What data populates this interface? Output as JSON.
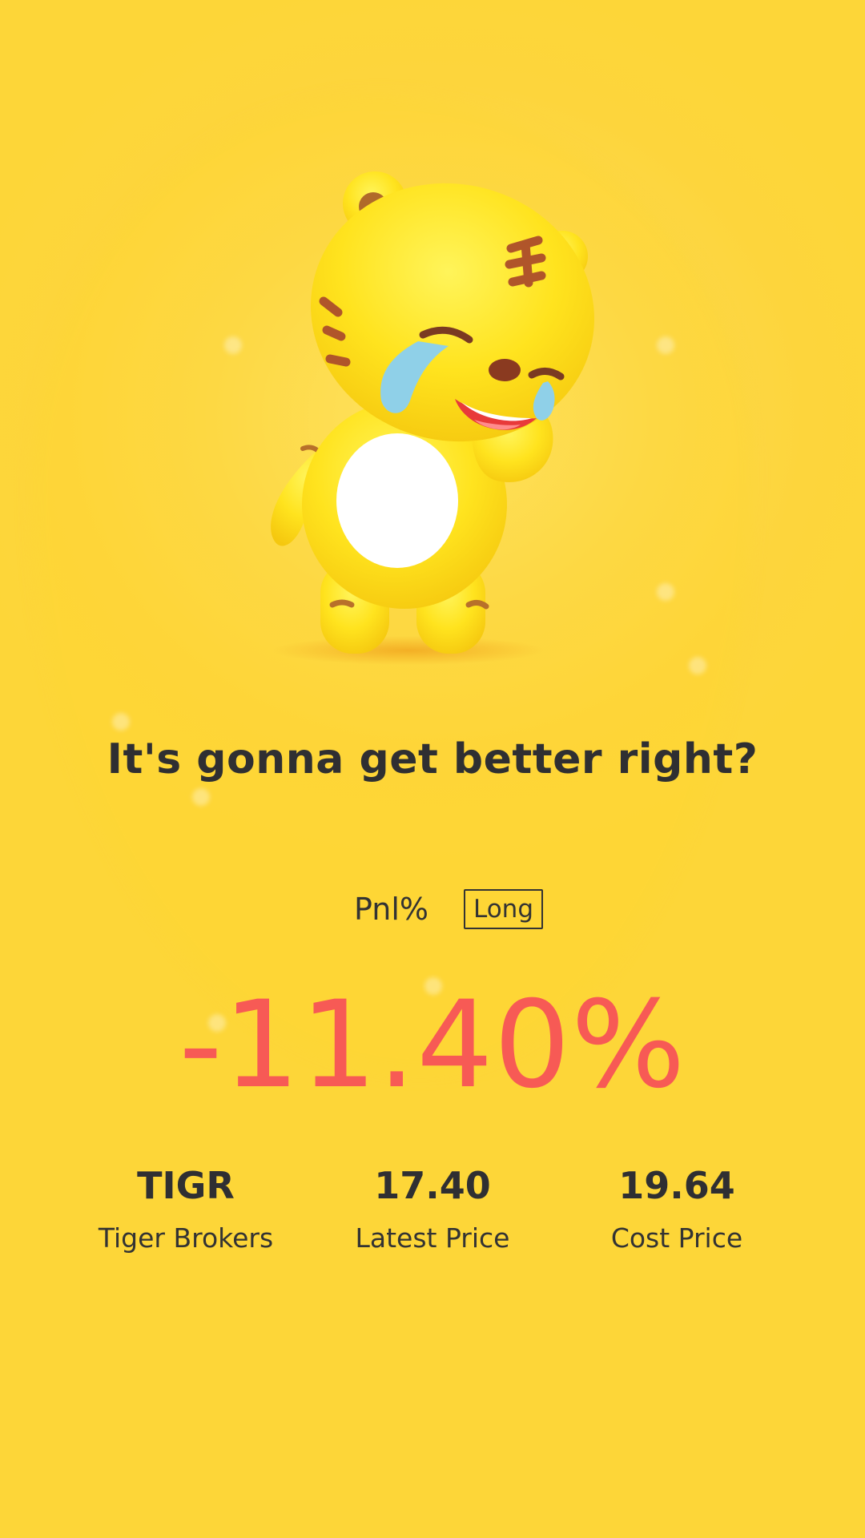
{
  "headline": "It's gonna get better right?",
  "pnl": {
    "label": "Pnl%",
    "side_badge": "Long",
    "value": "-11.40%"
  },
  "stats": [
    {
      "value": "TIGR",
      "label": "Tiger Brokers"
    },
    {
      "value": "17.40",
      "label": "Latest Price"
    },
    {
      "value": "19.64",
      "label": "Cost Price"
    }
  ],
  "colors": {
    "background": "#fdd638",
    "loss": "#f75a55",
    "text": "#2f2f32"
  },
  "illustration": "crying-tiger-mascot"
}
